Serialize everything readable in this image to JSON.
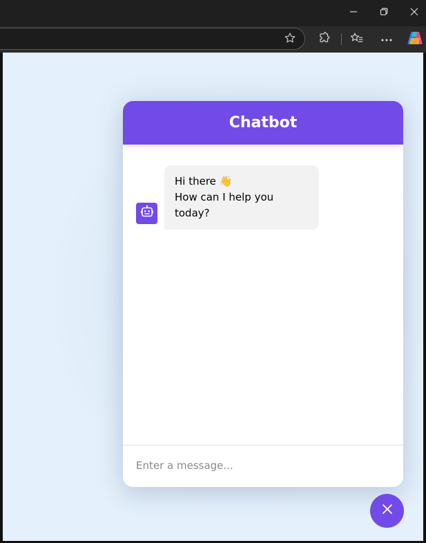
{
  "window_controls": {
    "minimize_icon": "minimize-icon",
    "restore_icon": "restore-icon",
    "close_icon": "close-icon"
  },
  "toolbar": {
    "favorite_icon": "star-icon",
    "extensions_icon": "puzzle-icon",
    "favorites_icon": "favorites-list-icon",
    "more_icon": "ellipsis-icon",
    "copilot_icon": "copilot-icon"
  },
  "chatbot": {
    "title": "Chatbot",
    "messages": [
      {
        "sender": "bot",
        "line1": "Hi there 👋",
        "line2": "How can I help you today?"
      }
    ],
    "input_placeholder": "Enter a message...",
    "toggler_icon": "close-icon"
  },
  "colors": {
    "accent": "#724ae8",
    "page_background": "#e4f0fb",
    "bubble_background": "#f2f2f2"
  }
}
